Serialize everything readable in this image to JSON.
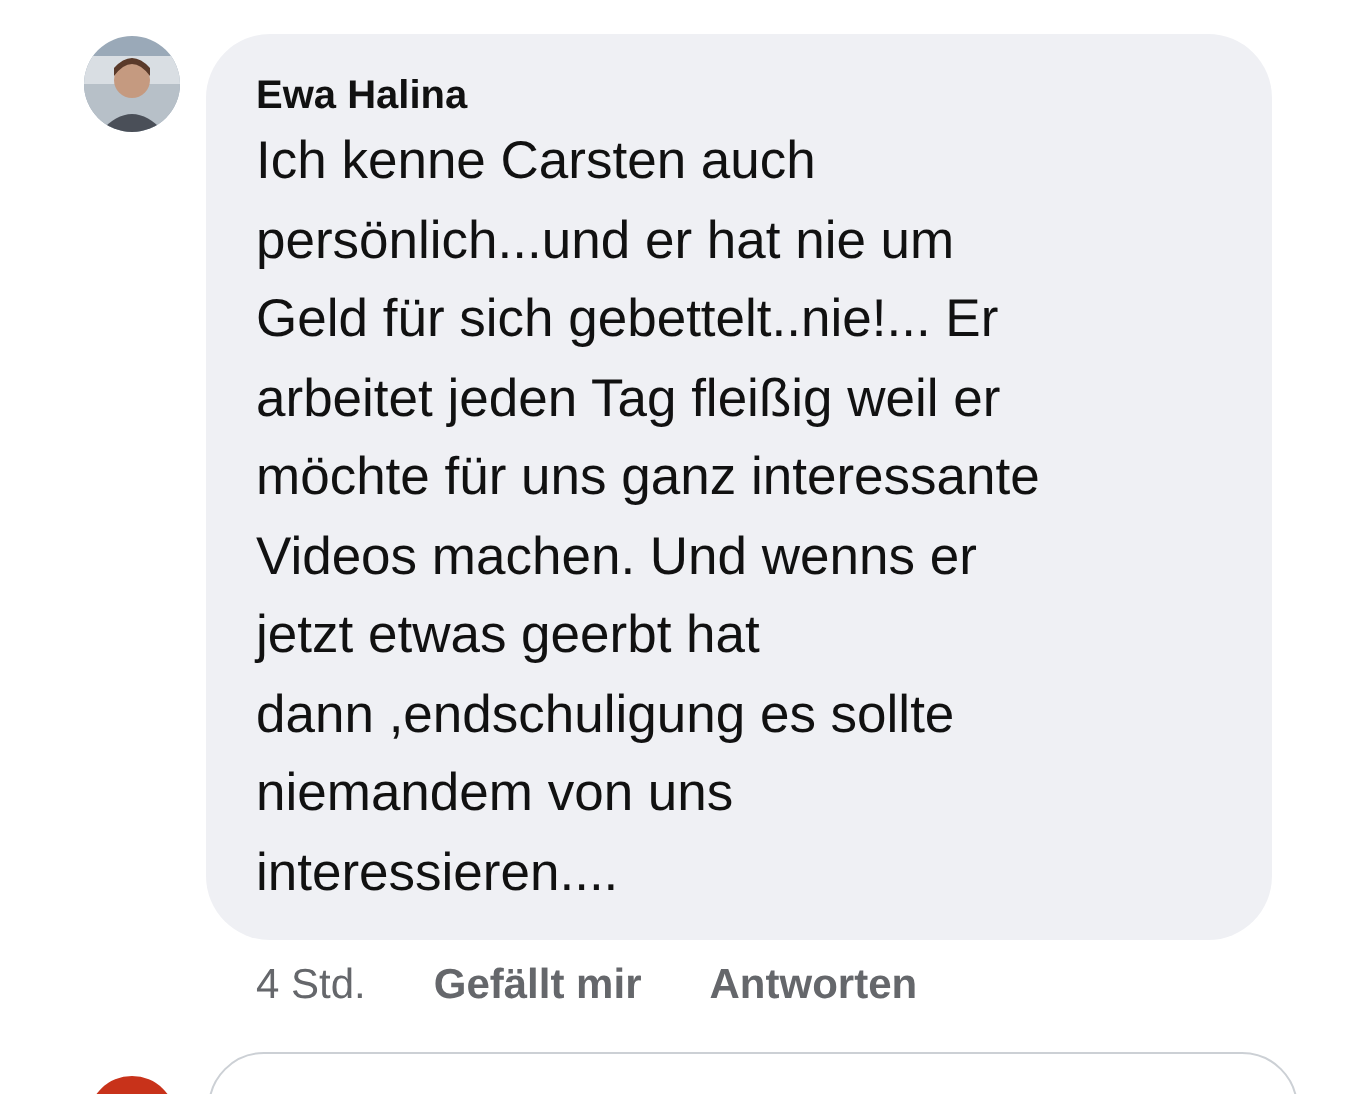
{
  "comment": {
    "author": "Ewa Halina",
    "lines": [
      "Ich kenne Carsten auch",
      "persönlich...und er hat nie um",
      "Geld für sich gebettelt..nie!... Er",
      "arbeitet jeden Tag fleißig weil er",
      "möchte für uns ganz interessante",
      "Videos machen. Und wenns er",
      "jetzt etwas geerbt hat",
      "dann ,endschuligung es sollte",
      "niemandem von uns",
      "interessieren...."
    ],
    "time": "4 Std.",
    "actions": [
      "Gefällt mir",
      "Antworten"
    ]
  }
}
